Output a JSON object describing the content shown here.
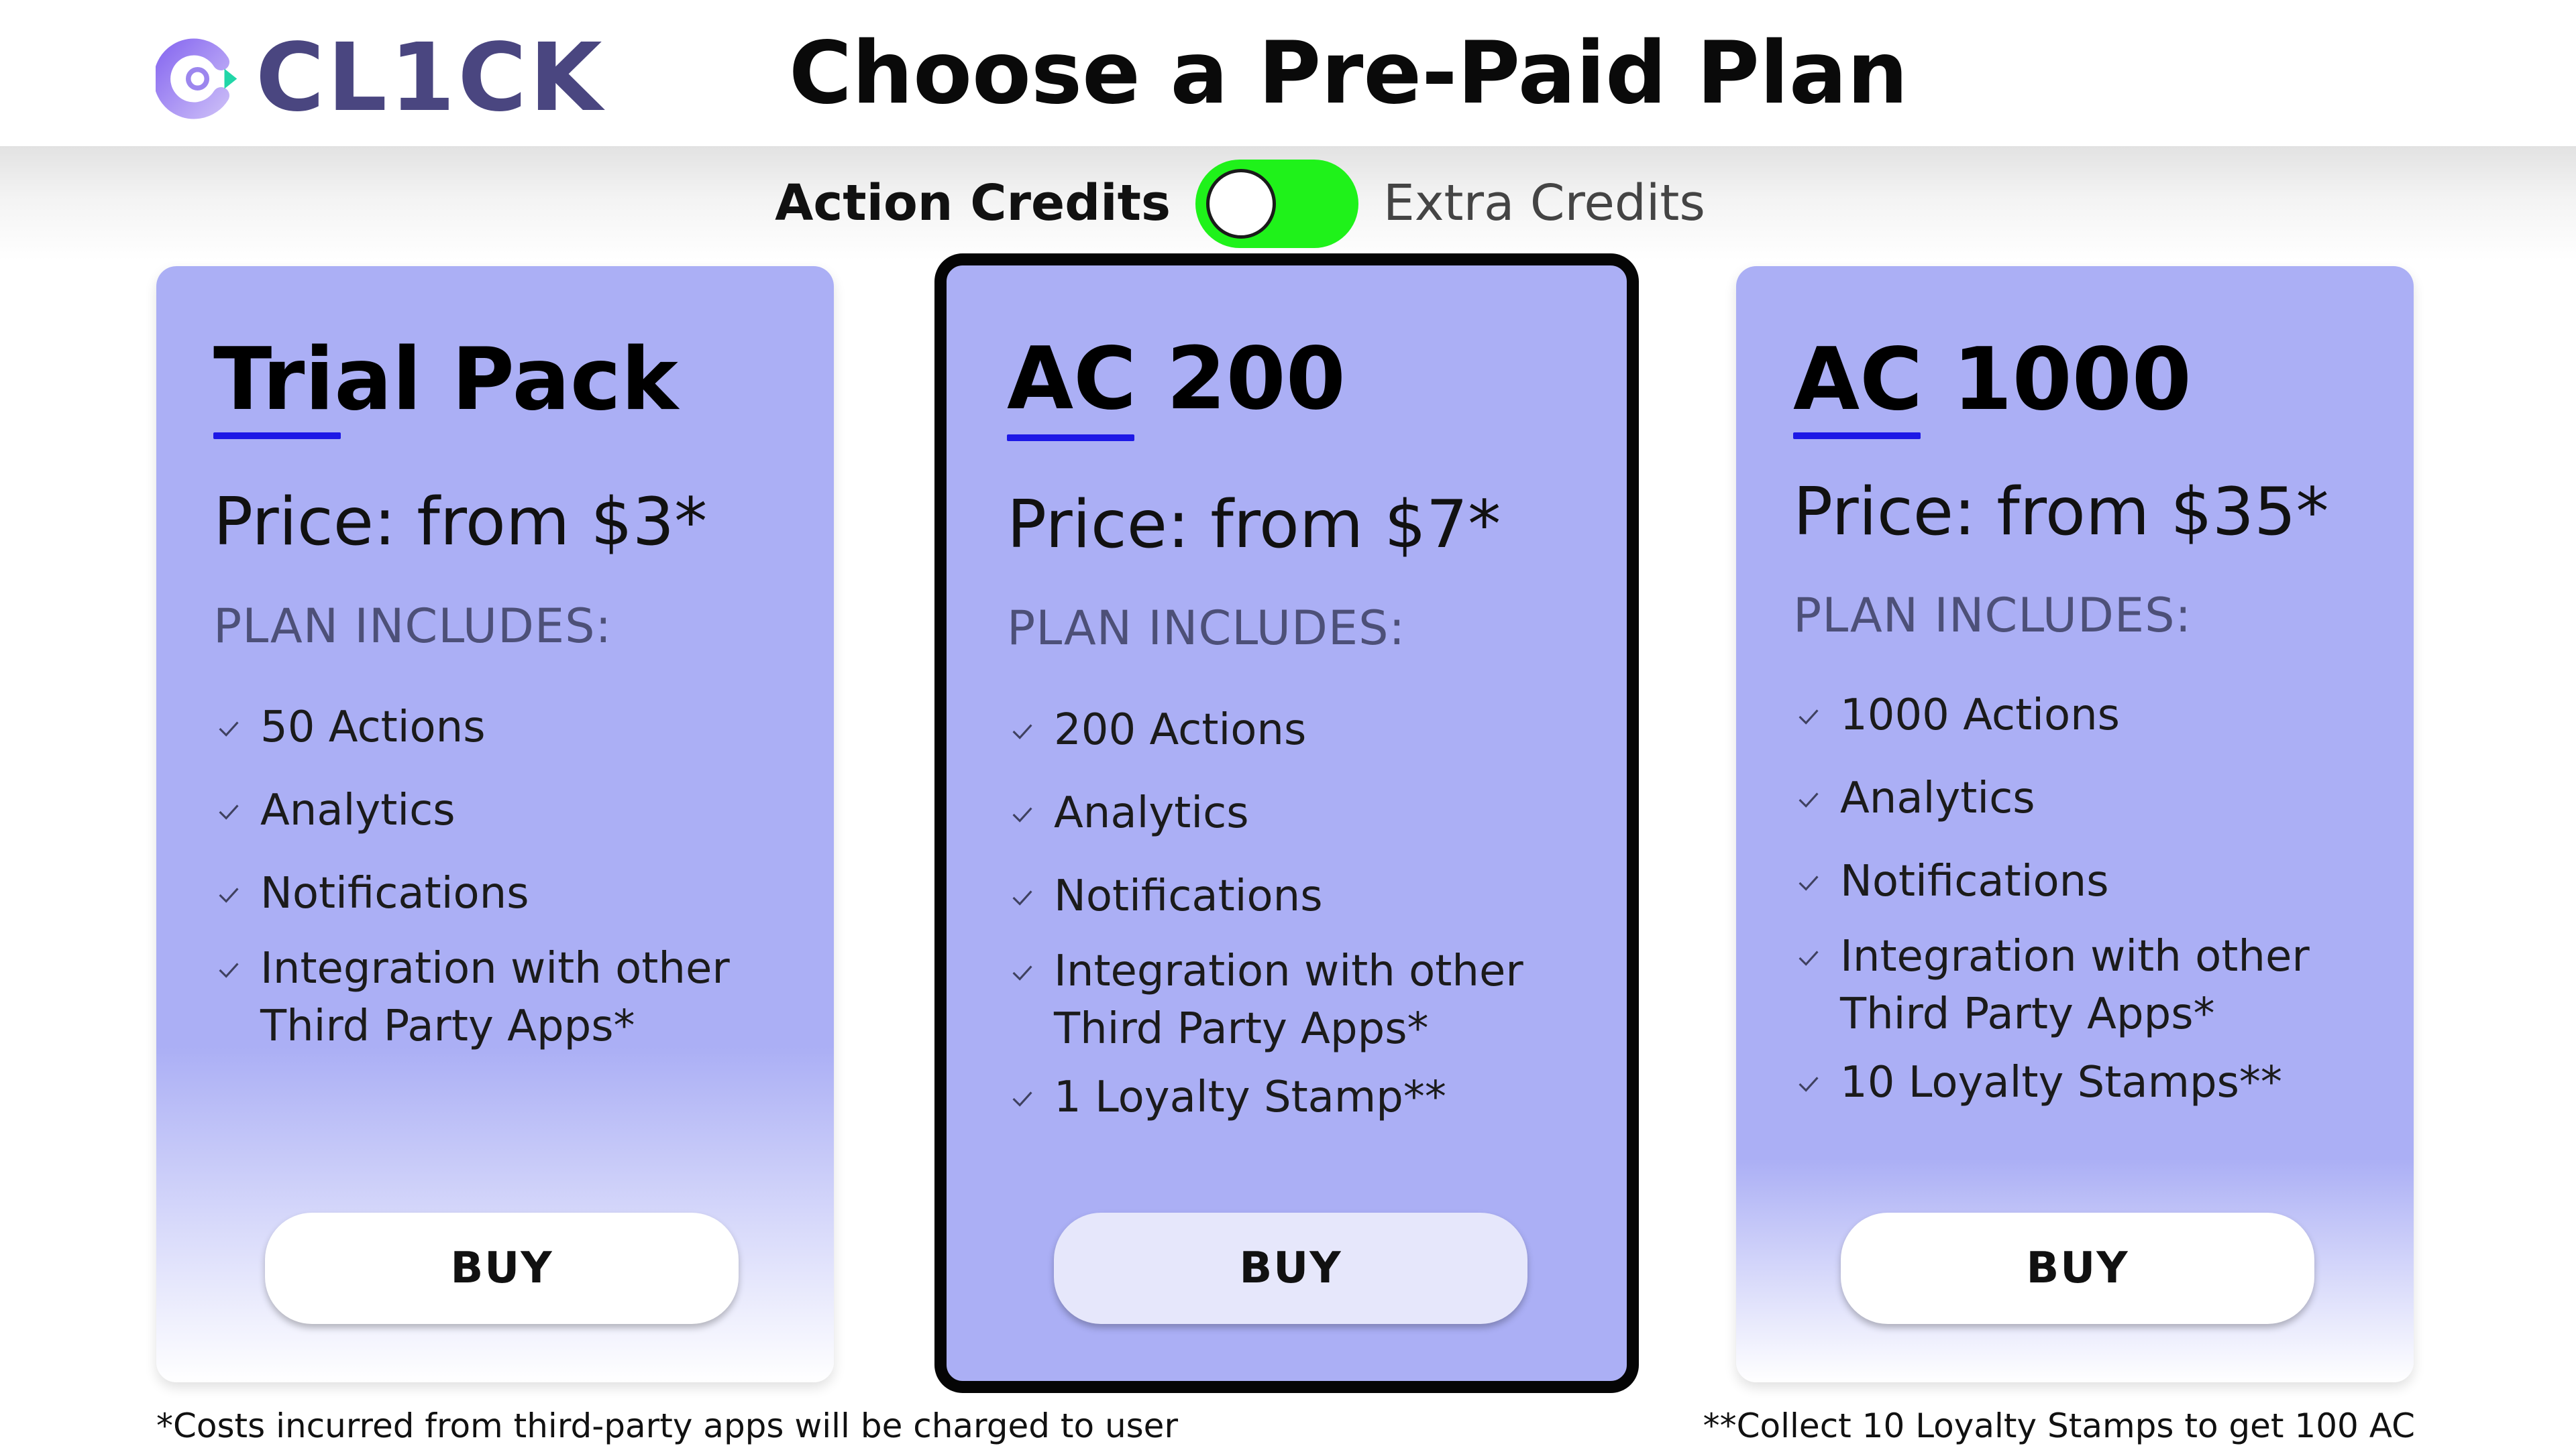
{
  "header": {
    "logo_text": "CL1CK",
    "title": "Choose a Pre-Paid Plan"
  },
  "toggle": {
    "left_label": "Action Credits",
    "right_label": "Extra Credits",
    "state": "off",
    "color": "#1ff21a"
  },
  "plans": [
    {
      "name": "Trial Pack",
      "price": "Price: from $3*",
      "includes_label": "PLAN INCLUDES:",
      "features": [
        "50 Actions",
        "Analytics",
        "Notifications",
        "Integration with other\nThird Party Apps*"
      ],
      "buy_label": "BUY"
    },
    {
      "name": "AC 200",
      "price": "Price: from $7*",
      "includes_label": "PLAN INCLUDES:",
      "features": [
        "200 Actions",
        "Analytics",
        "Notifications",
        "Integration with other\nThird Party Apps*",
        "1 Loyalty Stamp**"
      ],
      "buy_label": "BUY",
      "selected": true
    },
    {
      "name": "AC 1000",
      "price": "Price: from $35*",
      "includes_label": "PLAN INCLUDES:",
      "features": [
        "1000 Actions",
        "Analytics",
        "Notifications",
        "Integration with other\nThird Party Apps*",
        "10 Loyalty Stamps**"
      ],
      "buy_label": "BUY"
    }
  ],
  "footnotes": {
    "left": "*Costs incurred from third-party apps will be charged to user",
    "right": "**Collect 10 Loyalty Stamps to get 100 AC"
  },
  "colors": {
    "card": "#abaff5",
    "accent_underline": "#1d18e6",
    "logo": "#4a4680"
  }
}
